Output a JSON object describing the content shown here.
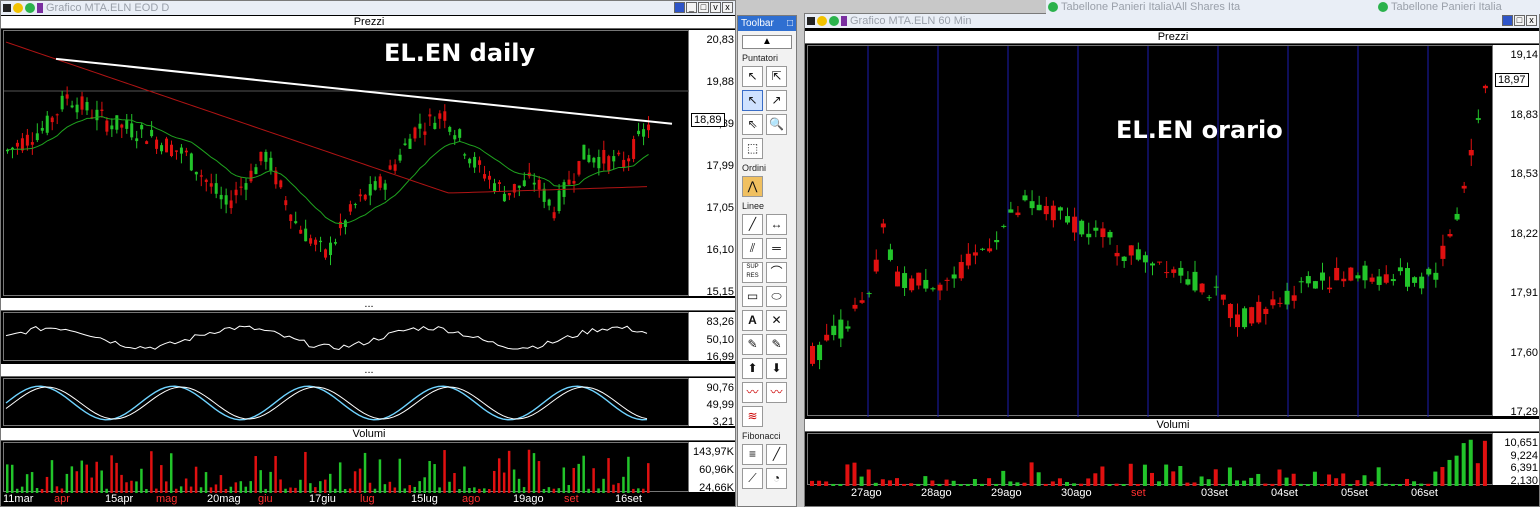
{
  "left_window": {
    "title": "Grafico MTA.ELN EOD D",
    "overlay_title": "EL.EN daily",
    "price_panel": "Prezzi",
    "price_ticks": [
      "20,83",
      "19,88",
      "18,89",
      "17,99",
      "17,05",
      "16,10",
      "15,15"
    ],
    "last_price": "18,89",
    "rsi_panel": "...",
    "rsi_ticks": [
      "83,26",
      "50,10",
      "16,99"
    ],
    "stoch_panel": "...",
    "stoch_ticks": [
      "90,76",
      "49,99",
      "3,21"
    ],
    "volume_panel": "Volumi",
    "volume_ticks": [
      "143,97K",
      "60,96K",
      "24,66K"
    ],
    "x_labels": [
      {
        "text": "11mar",
        "color": "#ffffff"
      },
      {
        "text": "apr",
        "color": "#ff3030"
      },
      {
        "text": "15apr",
        "color": "#ffffff"
      },
      {
        "text": "mag",
        "color": "#ff3030"
      },
      {
        "text": "20mag",
        "color": "#ffffff"
      },
      {
        "text": "giu",
        "color": "#ff3030"
      },
      {
        "text": "17giu",
        "color": "#ffffff"
      },
      {
        "text": "lug",
        "color": "#ff3030"
      },
      {
        "text": "15lug",
        "color": "#ffffff"
      },
      {
        "text": "ago",
        "color": "#ff3030"
      },
      {
        "text": "19ago",
        "color": "#ffffff"
      },
      {
        "text": "set",
        "color": "#ff3030"
      },
      {
        "text": "16set",
        "color": "#ffffff"
      }
    ]
  },
  "right_window": {
    "title": "Grafico MTA.ELN 60 Min",
    "overlay_title": "EL.EN orario",
    "price_panel": "Prezzi",
    "price_ticks": [
      "19,14",
      "18,83",
      "18,53",
      "18,22",
      "17,91",
      "17,60",
      "17,29"
    ],
    "last_price": "18,97",
    "volume_panel": "Volumi",
    "volume_ticks": [
      "10,651",
      "9,224",
      "6,391",
      "2,130"
    ],
    "x_labels": [
      {
        "text": "27ago",
        "color": "#ffffff"
      },
      {
        "text": "28ago",
        "color": "#ffffff"
      },
      {
        "text": "29ago",
        "color": "#ffffff"
      },
      {
        "text": "30ago",
        "color": "#ffffff"
      },
      {
        "text": "set",
        "color": "#ff3030"
      },
      {
        "text": "03set",
        "color": "#ffffff"
      },
      {
        "text": "04set",
        "color": "#ffffff"
      },
      {
        "text": "05set",
        "color": "#ffffff"
      },
      {
        "text": "06set",
        "color": "#ffffff"
      }
    ]
  },
  "top_windows": [
    "Tabellone Panieri Italia\\All Shares Ita",
    "Tabellone Panieri Italia"
  ],
  "toolbar": {
    "title": "Toolbar",
    "pin": "□",
    "sections": [
      "Puntatori",
      "Ordini",
      "Linee",
      "Fibonacci"
    ],
    "sup_res": "SUP RES"
  },
  "colors": {
    "up": "#22c42a",
    "down": "#e01010",
    "ema_short": "#1fa31f",
    "ema_long": "#b01414",
    "trendline": "#ffffff",
    "stoch_a": "#6fd3ff",
    "stoch_b": "#ffffff",
    "vgrid": "#1b1bb0"
  }
}
